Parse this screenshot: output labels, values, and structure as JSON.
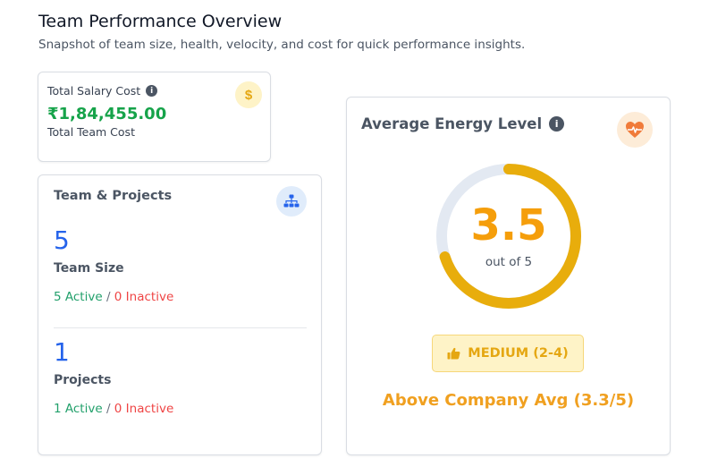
{
  "header": {
    "title": "Team Performance Overview",
    "subtitle": "Snapshot of team size, health, velocity, and cost for quick performance insights."
  },
  "salary": {
    "label": "Total Salary Cost",
    "value": "₹1,84,455.00",
    "sub_label": "Total Team Cost",
    "icon": "dollar-icon",
    "icon_glyph": "$",
    "info_glyph": "i"
  },
  "team": {
    "title": "Team & Projects",
    "icon": "org-chart-icon",
    "team_size": {
      "value": "5",
      "label": "Team Size",
      "active": "5 Active",
      "separator": "/",
      "inactive": "0 Inactive"
    },
    "projects": {
      "value": "1",
      "label": "Projects",
      "active": "1 Active",
      "separator": "/",
      "inactive": "0 Inactive"
    }
  },
  "energy": {
    "title": "Average Energy Level",
    "info_glyph": "i",
    "icon": "heart-pulse-icon",
    "score": "3.5",
    "score_fraction": 0.7,
    "out_of": "out of 5",
    "level_label": "MEDIUM (2-4)",
    "level_icon": "thumbs-up-icon",
    "company_avg": "Above Company Avg (3.3/5)"
  },
  "colors": {
    "accent_green": "#16a34a",
    "accent_blue": "#2563eb",
    "accent_amber": "#f59e0b",
    "inactive_red": "#ef4444",
    "gauge_track": "#e3e9f2",
    "gauge_fill": "#e8ad0c"
  }
}
